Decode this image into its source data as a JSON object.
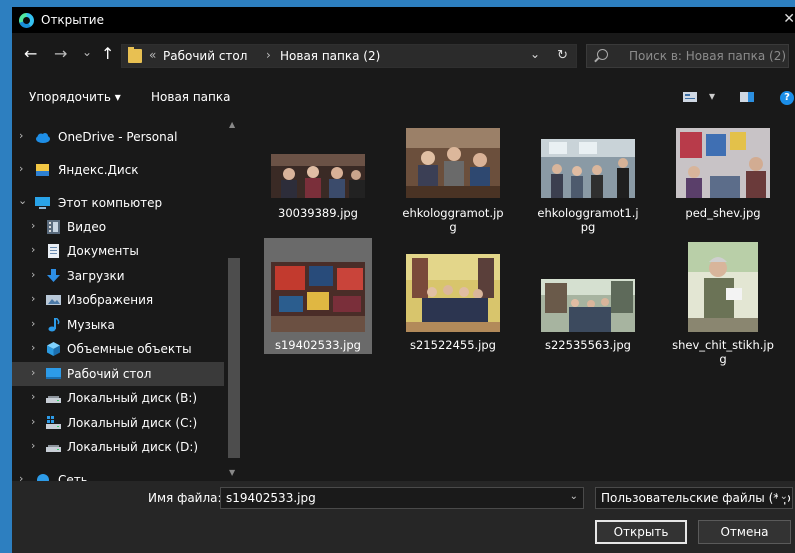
{
  "window": {
    "title": "Открытие",
    "close_glyph": "✕"
  },
  "nav": {
    "back_glyph": "←",
    "forward_glyph": "→",
    "recent_glyph": "⌄",
    "up_glyph": "↑"
  },
  "address": {
    "overflow": "«",
    "crumbs": [
      "Рабочий стол",
      "Новая папка (2)"
    ],
    "separator": "›",
    "dropdown_glyph": "⌄",
    "refresh_glyph": "↻"
  },
  "search": {
    "placeholder": "Поиск в: Новая папка (2)"
  },
  "toolbar": {
    "organize_label": "Упорядочить ▾",
    "new_folder_label": "Новая папка",
    "view_dropdown_glyph": "▾",
    "help_glyph": "?"
  },
  "sidebar": {
    "items": [
      {
        "label": "OneDrive - Personal",
        "icon": "cloud-icon"
      },
      {
        "label": "Яндекс.Диск",
        "icon": "yandex-disk-icon"
      },
      {
        "label": "Этот компьютер",
        "icon": "computer-icon"
      },
      {
        "label": "Видео",
        "icon": "video-icon"
      },
      {
        "label": "Документы",
        "icon": "documents-icon"
      },
      {
        "label": "Загрузки",
        "icon": "downloads-icon"
      },
      {
        "label": "Изображения",
        "icon": "pictures-icon"
      },
      {
        "label": "Музыка",
        "icon": "music-icon"
      },
      {
        "label": "Объемные объекты",
        "icon": "3d-objects-icon"
      },
      {
        "label": "Рабочий стол",
        "icon": "desktop-icon"
      },
      {
        "label": "Локальный диск (B:)",
        "icon": "drive-icon"
      },
      {
        "label": "Локальный диск (C:)",
        "icon": "system-drive-icon"
      },
      {
        "label": "Локальный диск (D:)",
        "icon": "drive-icon"
      },
      {
        "label": "Сеть",
        "icon": "network-icon"
      }
    ],
    "chevron_collapsed": "›",
    "chevron_expanded": "⌄",
    "scroll_up": "▲",
    "scroll_down": "▼"
  },
  "files": [
    {
      "name": "30039389.jpg"
    },
    {
      "name": "ehkologgramot.jpg"
    },
    {
      "name": "ehkologgramot1.jpg"
    },
    {
      "name": "ped_shev.jpg"
    },
    {
      "name": "s19402533.jpg"
    },
    {
      "name": "s21522455.jpg"
    },
    {
      "name": "s22535563.jpg"
    },
    {
      "name": "shev_chit_stikh.jpg"
    }
  ],
  "footer": {
    "filename_label": "Имя файла:",
    "filename_value": "s19402533.jpg",
    "filetype_value": "Пользовательские файлы (*.p",
    "dropdown_glyph": "⌄",
    "open_label": "Открыть",
    "cancel_label": "Отмена"
  },
  "colors": {
    "desktop_bg": "#2d7fc0",
    "window_bg": "#191919",
    "selection": "#3a3a3a",
    "accent": "#1b8ee8",
    "folder": "#e8c052"
  }
}
